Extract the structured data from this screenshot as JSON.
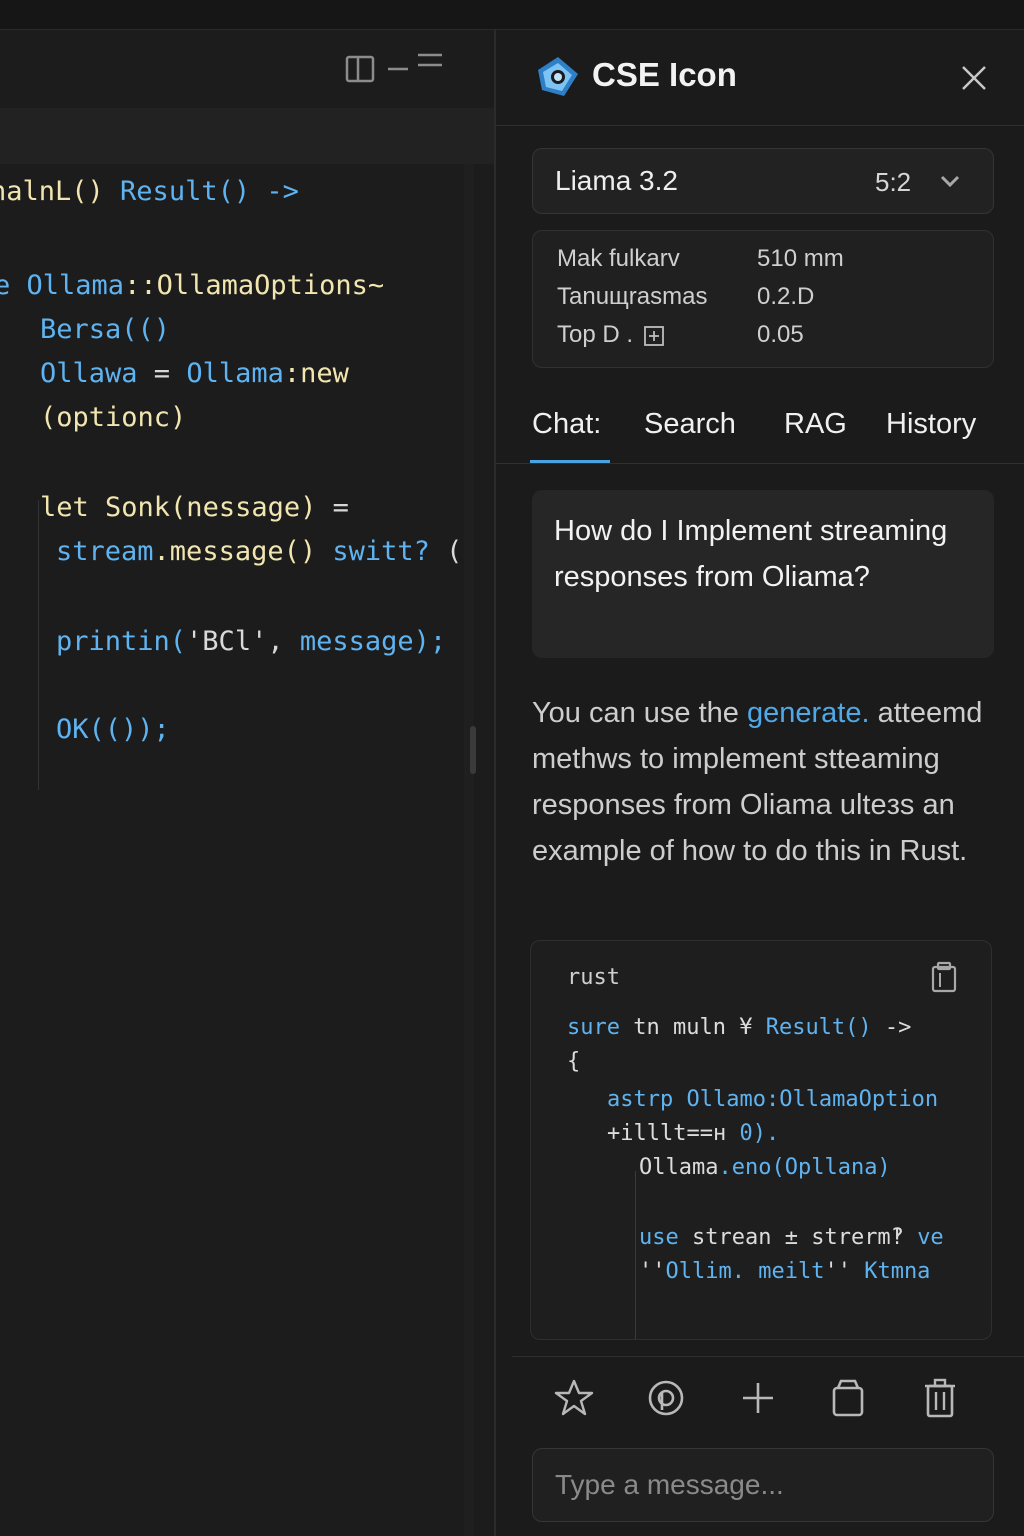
{
  "editor": {
    "toolbar_icons": [
      "panel-icon",
      "minus-icon",
      "menu-icon"
    ],
    "code_lines": [
      {
        "text_a": "nalnL() ",
        "text_b": "Result() ->"
      },
      {
        "text_a": "e ",
        "text_b": "Ollama",
        "text_c": "::OllamaOptions~"
      },
      {
        "text_a": "Bersa(()"
      },
      {
        "text_a": "Ollawa",
        "text_b": " = ",
        "text_c": "Ollama",
        "text_d": ":new"
      },
      {
        "text_a": "(optionc)"
      },
      {
        "text_a": "let ",
        "text_b": "Sonk(nessage)",
        "text_c": " ="
      },
      {
        "text_a": "stream",
        "text_b": ".message() ",
        "text_c": "switt?",
        "text_d": " ("
      },
      {
        "text_a": "printin(",
        "text_b": "'BCl'",
        "text_c": ", ",
        "text_d": "message);"
      },
      {
        "text_a": "OK(());"
      }
    ]
  },
  "panel": {
    "title": "CSE Icon",
    "model": {
      "name": "Liama 3.2",
      "version": "5:2"
    },
    "params": [
      {
        "label": "Mak fulkarv",
        "value": "510 mm"
      },
      {
        "label": "Tanuщraѕmas",
        "value": "0.2.D"
      },
      {
        "label": "Top D .",
        "value": "0.05"
      }
    ],
    "tabs": [
      "Chat:",
      "Search",
      "RAG",
      "History"
    ],
    "active_tab": "Chat:",
    "question": "How do I Implement streaming responses from Oliama?",
    "answer": {
      "pre": "You can use the ",
      "link": "generate.",
      "post": " atteemd methws to implement stteaming responses from Oliama ulteзs an example of how to do this in Rust."
    },
    "code_block": {
      "language": "rust",
      "lines": [
        {
          "a": "sure",
          "b": " tn muln ",
          "c": "¥ ",
          "d": "Result()",
          "e": " ->"
        },
        {
          "a": "{"
        },
        {
          "a": "astrp",
          "b": " Ollamo",
          "c": ":OllamaOption"
        },
        {
          "a": "+illlt",
          "b": "==н ",
          "c": "0)."
        },
        {
          "a": "Ollama",
          "b": ".eno(",
          "c": "Opllana)"
        },
        {
          "a": "use",
          "b": " strean ",
          "c": "± strerm",
          "d": "‽ ",
          "e": "ve"
        },
        {
          "a": "''",
          "b": "Ollim. meilt",
          "c": "'' ",
          "d": "Ktmna"
        }
      ]
    },
    "actions": [
      "star-icon",
      "at-icon",
      "plus-icon",
      "archive-icon",
      "trash-icon"
    ],
    "input_placeholder": "Type a message..."
  }
}
